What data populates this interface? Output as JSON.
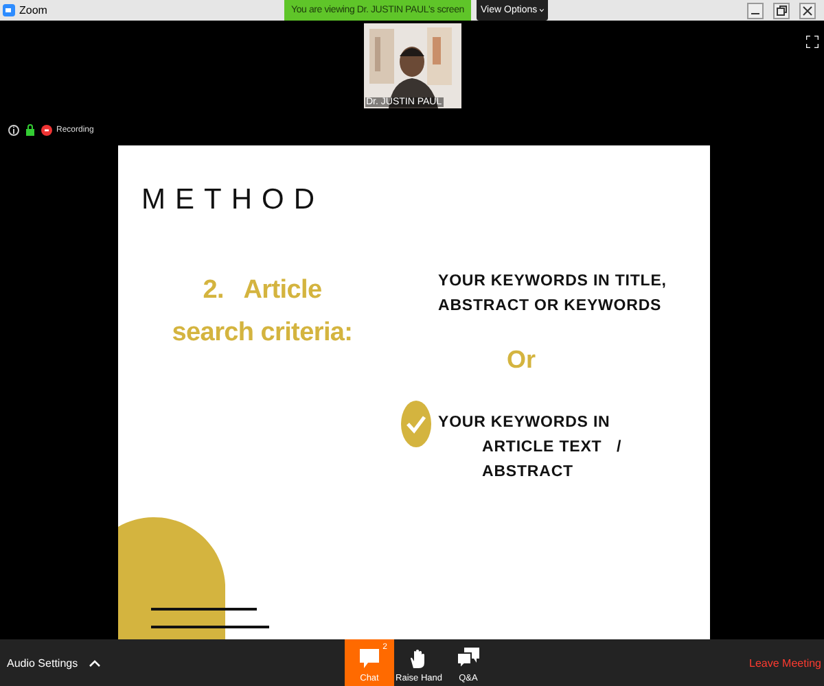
{
  "window": {
    "title": "Zoom"
  },
  "share_banner": {
    "text": "You are viewing Dr. JUSTIN PAUL's screen",
    "menu": "View Options"
  },
  "video": {
    "kind": "picture",
    "name": "Dr. JUSTIN PAUL"
  },
  "status": {
    "recording": "Recording"
  },
  "slide": {
    "title": "METHOD",
    "heading_lines": [
      "2.   Article",
      "search criteria:"
    ],
    "options": [
      {
        "lines": [
          "YOUR KEYWORDS IN TITLE,",
          "ABSTRACT OR KEYWORDS"
        ],
        "checked": false
      },
      {
        "lines": [
          "YOUR KEYWORDS IN",
          "ARTICLE TEXT   /",
          "ABSTRACT"
        ],
        "checked": true
      }
    ],
    "separator": "Or"
  },
  "toolbar": {
    "audio": "Audio Settings",
    "buttons": [
      {
        "kind": "chat",
        "label": "Chat",
        "badge": "2",
        "selected": true
      },
      {
        "kind": "hand",
        "label": "Raise Hand",
        "selected": false
      },
      {
        "kind": "qa",
        "label": "Q&A",
        "selected": false
      }
    ],
    "leave": "Leave Meeting"
  }
}
